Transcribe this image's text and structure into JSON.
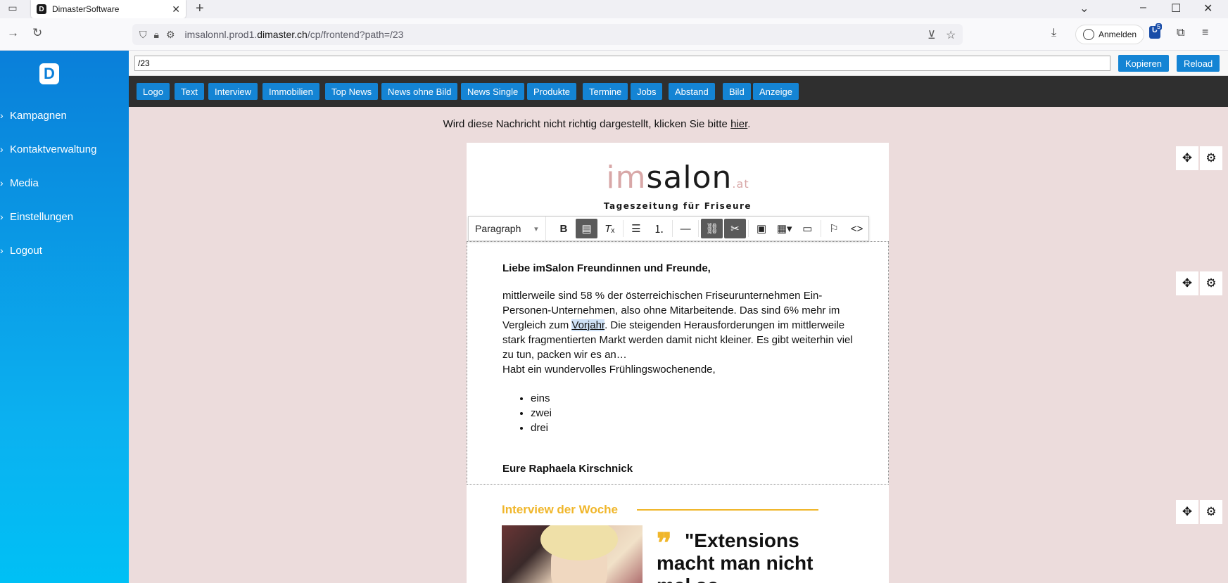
{
  "browser": {
    "tab_title": "DimasterSoftware",
    "url_prefix": "imsalonnl.prod1.",
    "url_domain": "dimaster.ch",
    "url_path": "/cp/frontend?path=/23",
    "signin_label": "Anmelden",
    "extension_badge": "5"
  },
  "sidebar": {
    "logo_letter": "D",
    "items": [
      {
        "label": "Kampagnen"
      },
      {
        "label": "Kontaktverwaltung"
      },
      {
        "label": "Media"
      },
      {
        "label": "Einstellungen"
      },
      {
        "label": "Logout"
      }
    ]
  },
  "editor": {
    "path_value": "/23",
    "copy_label": "Kopieren",
    "reload_label": "Reload",
    "blocks": [
      {
        "label": "Logo"
      },
      {
        "label": "Text"
      },
      {
        "label": "Interview"
      },
      {
        "label": "Immobilien"
      },
      {
        "label": "Top News"
      },
      {
        "label": "News ohne Bild"
      },
      {
        "label": "News Single"
      },
      {
        "label": "Produkte"
      },
      {
        "label": "Termine"
      },
      {
        "label": "Jobs"
      },
      {
        "label": "Abstand"
      },
      {
        "label": "Bild"
      },
      {
        "label": "Anzeige"
      }
    ]
  },
  "newsletter": {
    "notice_text": "Wird diese Nachricht nicht richtig dargestellt, klicken Sie bitte ",
    "notice_link": "hier",
    "notice_end": ".",
    "logo_im": "im",
    "logo_salon": "salon",
    "logo_at": ".at",
    "logo_tagline": "Tageszeitung für Friseure",
    "toolbar_format": "Paragraph",
    "greeting": "Liebe imSalon Freundinnen und Freunde,",
    "paragraph_part1": "mittlerweile sind 58 % der österreichischen Friseurunternehmen Ein-Personen-Unternehmen, also ohne Mitarbeitende. Das sind 6% mehr im Vergleich zum ",
    "paragraph_highlight": "Vorjahr",
    "paragraph_part2": ". Die steigenden Herausforderungen im mittlerweile stark fragmentierten Markt werden damit nicht kleiner. Es gibt weiterhin viel zu tun, packen wir es an…",
    "closing_line": "Habt ein wundervolles Frühlingswochenende,",
    "bullets": [
      "eins",
      "zwei",
      "drei"
    ],
    "signature": "Eure Raphaela Kirschnick",
    "section_title": "Interview der Woche",
    "quote_mark": "❞",
    "quote_text": "\"Extensions macht man nicht mal so"
  },
  "colors": {
    "accent_blue": "#1484d4",
    "interview_gold": "#f0b62a",
    "canvas_pink": "#ecdcdc"
  }
}
